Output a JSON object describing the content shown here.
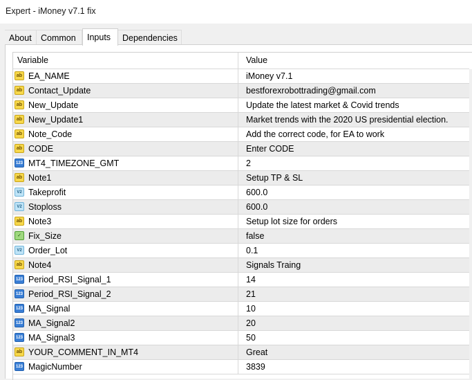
{
  "window": {
    "title": "Expert - iMoney v7.1 fix"
  },
  "tabs": [
    {
      "label": "About"
    },
    {
      "label": "Common"
    },
    {
      "label": "Inputs"
    },
    {
      "label": "Dependencies"
    }
  ],
  "active_tab": "Inputs",
  "table": {
    "columns": {
      "variable": "Variable",
      "value": "Value"
    },
    "rows": [
      {
        "icon": "ab-string-icon",
        "variable": "EA_NAME",
        "value": "iMoney v7.1"
      },
      {
        "icon": "ab-string-icon",
        "variable": "Contact_Update",
        "value": "bestforexrobottrading@gmail.com"
      },
      {
        "icon": "ab-string-icon",
        "variable": "New_Update",
        "value": "Update the latest market & Covid trends"
      },
      {
        "icon": "ab-string-icon",
        "variable": "New_Update1",
        "value": "Market trends with the 2020 US presidential election."
      },
      {
        "icon": "ab-string-icon",
        "variable": "Note_Code",
        "value": "Add the correct code, for EA to work"
      },
      {
        "icon": "ab-string-icon",
        "variable": "CODE",
        "value": "Enter CODE"
      },
      {
        "icon": "integer-icon",
        "variable": "MT4_TIMEZONE_GMT",
        "value": "2"
      },
      {
        "icon": "ab-string-icon",
        "variable": "Note1",
        "value": "Setup TP & SL"
      },
      {
        "icon": "double-icon",
        "variable": "Takeprofit",
        "value": "600.0"
      },
      {
        "icon": "double-icon",
        "variable": "Stoploss",
        "value": "600.0"
      },
      {
        "icon": "ab-string-icon",
        "variable": "Note3",
        "value": "Setup lot size for orders"
      },
      {
        "icon": "bool-icon",
        "variable": "Fix_Size",
        "value": "false"
      },
      {
        "icon": "double-icon",
        "variable": "Order_Lot",
        "value": "0.1"
      },
      {
        "icon": "ab-string-icon",
        "variable": "Note4",
        "value": "Signals Traing"
      },
      {
        "icon": "integer-icon",
        "variable": "Period_RSI_Signal_1",
        "value": "14"
      },
      {
        "icon": "integer-icon",
        "variable": "Period_RSI_Signal_2",
        "value": "21"
      },
      {
        "icon": "integer-icon",
        "variable": "MA_Signal",
        "value": "10"
      },
      {
        "icon": "integer-icon",
        "variable": "MA_Signal2",
        "value": "20"
      },
      {
        "icon": "integer-icon",
        "variable": "MA_Signal3",
        "value": "50"
      },
      {
        "icon": "ab-string-icon",
        "variable": "YOUR_COMMENT_IN_MT4",
        "value": "Great"
      },
      {
        "icon": "integer-icon",
        "variable": "MagicNumber",
        "value": "3839"
      }
    ]
  },
  "colors": {
    "row_alt": "#ececec",
    "string_icon": "#f7d84b",
    "integer_icon": "#3a7fd6",
    "double_icon": "#bfe4f7",
    "bool_icon": "#9fd87f"
  }
}
